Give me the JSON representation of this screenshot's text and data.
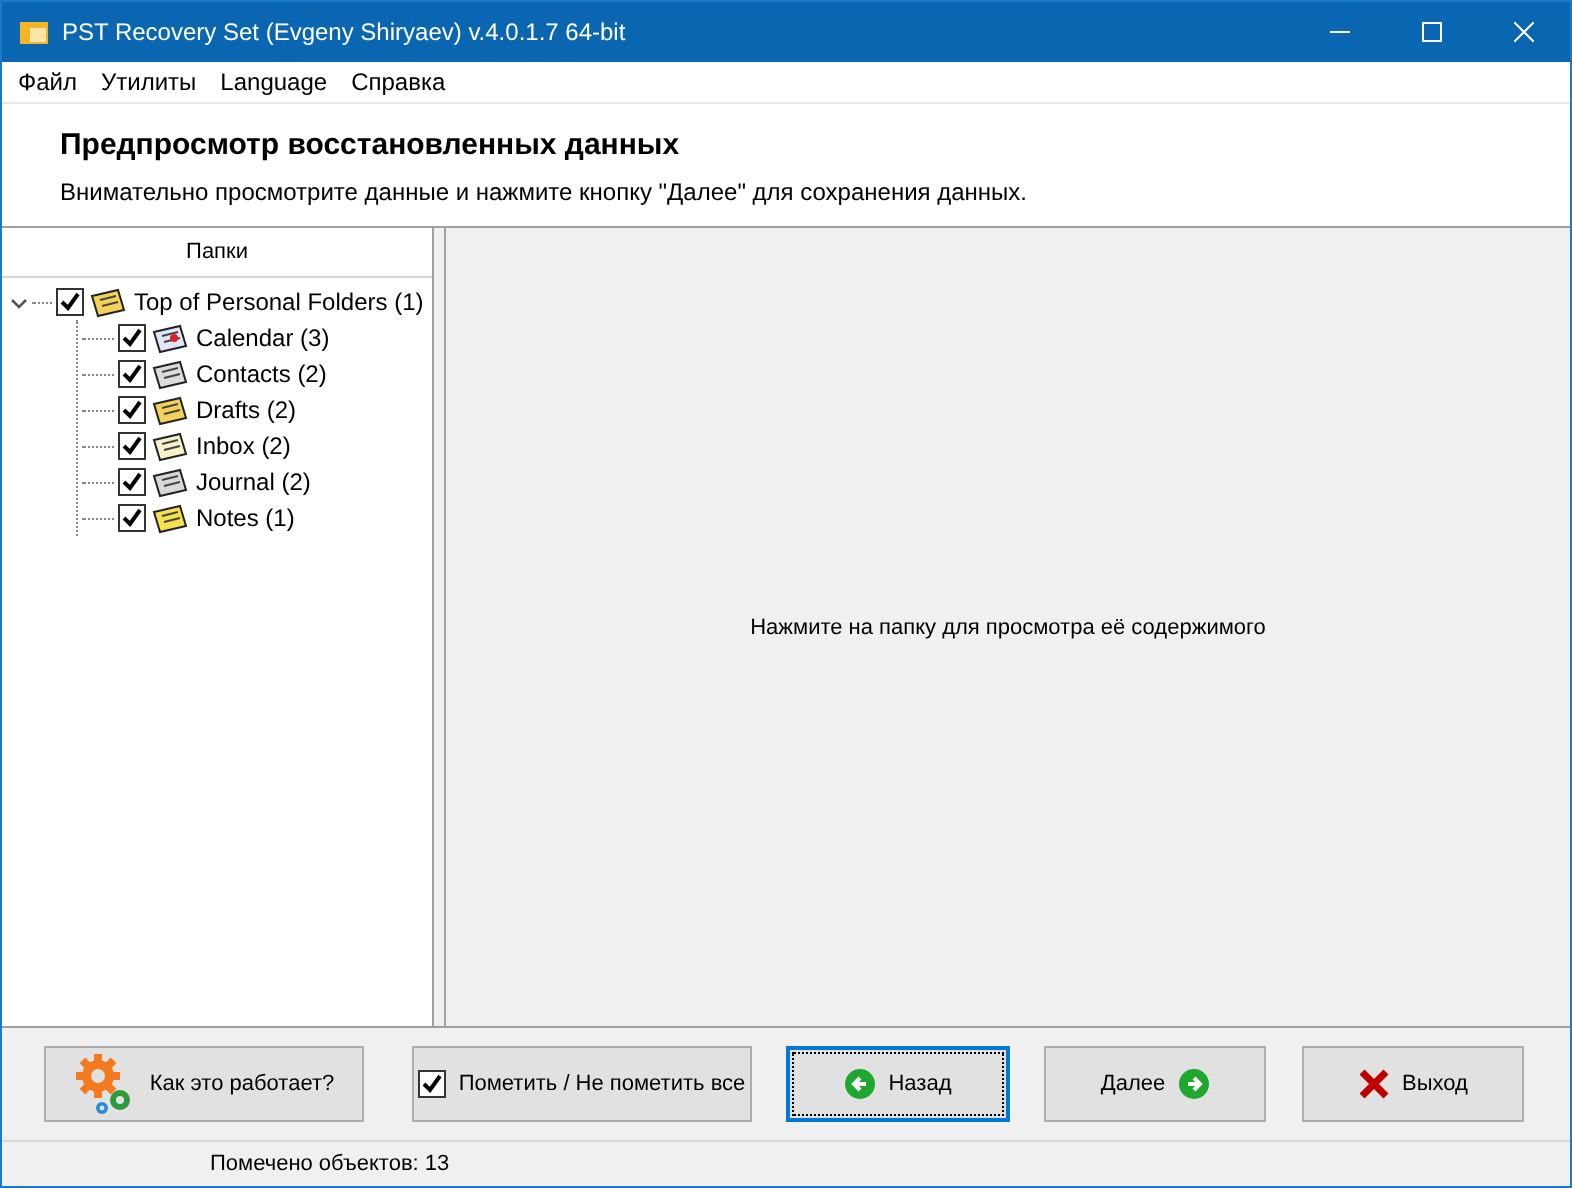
{
  "window": {
    "title": "PST Recovery Set (Evgeny Shiryaev) v.4.0.1.7 64-bit"
  },
  "menu": [
    "Файл",
    "Утилиты",
    "Language",
    "Справка"
  ],
  "header": {
    "title": "Предпросмотр восстановленных данных",
    "subtitle": "Внимательно просмотрите данные и нажмите кнопку \"Далее\" для сохранения данных."
  },
  "tree": {
    "heading": "Папки",
    "items": [
      {
        "label": "Top of Personal Folders (1)",
        "checked": true,
        "expanded": true,
        "kind": "root",
        "children": [
          {
            "label": "Calendar (3)",
            "checked": true,
            "kind": "calendar"
          },
          {
            "label": "Contacts (2)",
            "checked": true,
            "kind": "contacts"
          },
          {
            "label": "Drafts (2)",
            "checked": true,
            "kind": "drafts"
          },
          {
            "label": "Inbox (2)",
            "checked": true,
            "kind": "inbox"
          },
          {
            "label": "Journal (2)",
            "checked": true,
            "kind": "journal"
          },
          {
            "label": "Notes (1)",
            "checked": true,
            "kind": "notes"
          }
        ]
      }
    ]
  },
  "preview": {
    "message": "Нажмите на папку для просмотра её содержимого"
  },
  "buttons": [
    {
      "kind": "help",
      "label": "Как это работает?",
      "focused": false
    },
    {
      "kind": "toggle",
      "label": "Пометить / Не пометить все",
      "checked": true,
      "focused": false
    },
    {
      "kind": "back",
      "label": "Назад",
      "focused": true
    },
    {
      "kind": "next",
      "label": "Далее",
      "focused": false
    },
    {
      "kind": "exit",
      "label": "Выход",
      "focused": false
    }
  ],
  "status_bar": {
    "text": "Помечено объектов: 13"
  }
}
